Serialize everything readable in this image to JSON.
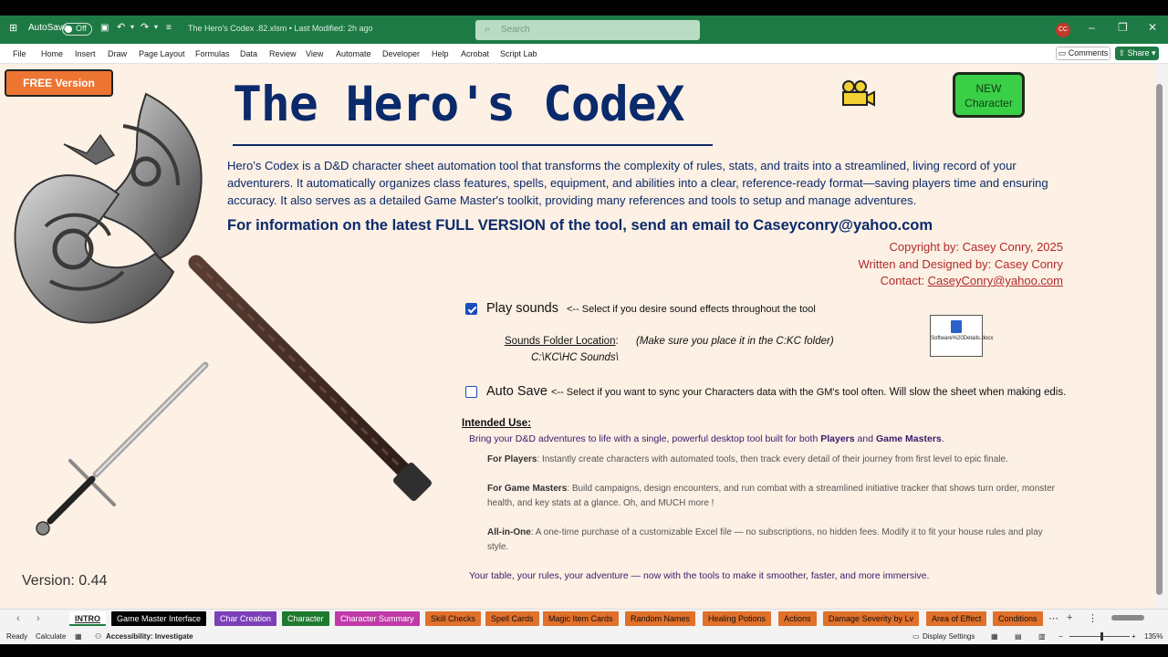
{
  "titlebar": {
    "autosave_label": "AutoSave",
    "autosave_state": "Off",
    "file_title": "The Hero's Codex .82.xlsm • Last Modified: 2h ago",
    "search_placeholder": "Search",
    "user_initials": "CC",
    "accent_color": "#1e7a45"
  },
  "ribbon": {
    "tabs": [
      "File",
      "Home",
      "Insert",
      "Draw",
      "Page Layout",
      "Formulas",
      "Data",
      "Review",
      "View",
      "Automate",
      "Developer",
      "Help",
      "Acrobat",
      "Script Lab"
    ],
    "comments_label": "Comments",
    "share_label": "Share"
  },
  "sheet": {
    "free_version_label": "FREE Version",
    "new_character_line1": "NEW",
    "new_character_line2": "Character",
    "title": "The Hero's CodeX",
    "description": "Hero’s Codex is a D&D character sheet automation tool that transforms the complexity of rules, stats, and traits into a streamlined, living record of your adventurers. It automatically organizes class features, spells, equipment, and abilities into a clear, reference-ready format—saving players time and ensuring accuracy. It also serves as a detailed Game Master's toolkit, providing many references and tools to setup and manage adventures.",
    "info_line": "For information on the latest FULL VERSION of the tool, send an email to Caseyconry@yahoo.com",
    "copyright": "Copyright by: Casey Conry, 2025",
    "written_by": "Written and Designed by: Casey Conry",
    "contact_label": "Contact: ",
    "contact_email": "CaseyConry@yahoo.com",
    "play_sounds": {
      "label": "Play sounds",
      "note": "<-- Select if you desire sound effects throughout the tool",
      "checked": true
    },
    "sounds_folder_label": "Sounds Folder Location",
    "sounds_folder_colon": ":",
    "sounds_folder_path": "C:\\KC\\HC Sounds\\",
    "sounds_folder_note": "(Make sure you place it in the C:KC folder)",
    "attachment_label": "Software%20Details.docx",
    "auto_save": {
      "label": "Auto Save",
      "note_a": "<-- Select if you want to sync your Characters data with the GM's tool often.",
      "note_b": " Will slow the sheet when making edis.",
      "checked": false
    },
    "intended_use_heading": "Intended Use:",
    "intended_intro_a": "Bring your D&D adventures to life with a single, powerful desktop tool built for both ",
    "intended_intro_players": "Players",
    "intended_intro_and": " and ",
    "intended_intro_gms": "Game Masters",
    "intended_intro_end": ".",
    "for_players_label": "For Players",
    "for_players_text": ": Instantly create characters with automated tools, then track every detail of their journey from first level to epic finale.",
    "for_gms_label": "For Game Masters",
    "for_gms_text": ": Build campaigns, design encounters, and run combat with a streamlined initiative tracker that shows turn order, monster health, and key stats at a glance. Oh, and MUCH more !",
    "all_in_one_label": "All-in-One",
    "all_in_one_text": ": A one-time purchase of a customizable Excel file — no subscriptions, no hidden fees. Modify it to fit your house rules and play style.",
    "closing": "Your table, your rules, your adventure — now with the tools to make it smoother, faster, and more immersive.",
    "version": "Version:  0.44"
  },
  "sheet_tabs": [
    {
      "label": "INTRO",
      "color": "#ffffff"
    },
    {
      "label": "Game Master Interface",
      "color": "#000000"
    },
    {
      "label": "Char Creation",
      "color": "#7b3fb8"
    },
    {
      "label": "Character",
      "color": "#1e7a2e"
    },
    {
      "label": "Character Summary",
      "color": "#c03aa8"
    },
    {
      "label": "Skill Checks",
      "color": "#e0702a"
    },
    {
      "label": "Spell Cards",
      "color": "#e0702a"
    },
    {
      "label": "Magic Item Cards",
      "color": "#e0702a"
    },
    {
      "label": "Random Names",
      "color": "#e0702a"
    },
    {
      "label": "Healing Potions",
      "color": "#e0702a"
    },
    {
      "label": "Actions",
      "color": "#e0702a"
    },
    {
      "label": "Damage Severity by Lv",
      "color": "#e0702a"
    },
    {
      "label": "Area of Effect",
      "color": "#e0702a"
    },
    {
      "label": "Conditions",
      "color": "#e0702a"
    }
  ],
  "statusbar": {
    "ready": "Ready",
    "calculate": "Calculate",
    "accessibility": "Accessibility: Investigate",
    "display_settings": "Display Settings",
    "zoom_minus": "−",
    "zoom_plus": "+",
    "zoom": "135%"
  }
}
